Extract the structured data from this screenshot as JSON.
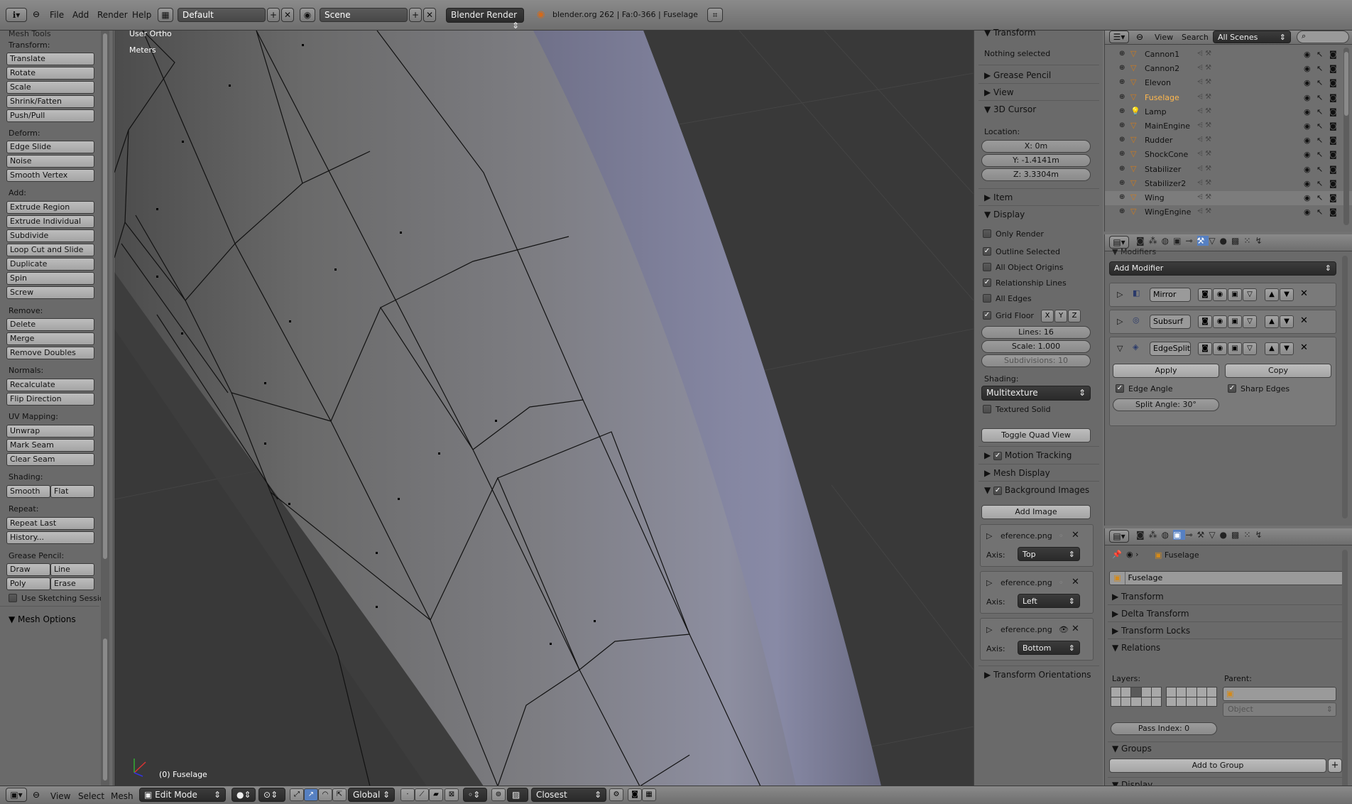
{
  "header": {
    "menus": [
      "File",
      "Add",
      "Render",
      "Help"
    ],
    "screen_layout": "Default",
    "scene": "Scene",
    "render_engine": "Blender Render",
    "stats": "blender.org 262 | Fa:0-366 | Fuselage"
  },
  "toolshelf": {
    "title": "Mesh Tools",
    "transform_label": "Transform:",
    "transform": [
      "Translate",
      "Rotate",
      "Scale",
      "Shrink/Fatten",
      "Push/Pull"
    ],
    "deform_label": "Deform:",
    "deform": [
      "Edge Slide",
      "Noise",
      "Smooth Vertex"
    ],
    "add_label": "Add:",
    "add": [
      "Extrude Region",
      "Extrude Individual",
      "Subdivide",
      "Loop Cut and Slide",
      "Duplicate",
      "Spin",
      "Screw"
    ],
    "remove_label": "Remove:",
    "remove": [
      "Delete",
      "Merge",
      "Remove Doubles"
    ],
    "normals_label": "Normals:",
    "normals": [
      "Recalculate",
      "Flip Direction"
    ],
    "uv_label": "UV Mapping:",
    "uv": [
      "Unwrap",
      "Mark Seam",
      "Clear Seam"
    ],
    "shading_label": "Shading:",
    "shading_smooth": "Smooth",
    "shading_flat": "Flat",
    "repeat_label": "Repeat:",
    "repeat": [
      "Repeat Last",
      "History..."
    ],
    "grease_label": "Grease Pencil:",
    "grease_draw": "Draw",
    "grease_line": "Line",
    "grease_poly": "Poly",
    "grease_erase": "Erase",
    "sketching": "Use Sketching Sessio",
    "mesh_options": "Mesh Options"
  },
  "viewport": {
    "view_name": "User Ortho",
    "units": "Meters",
    "object_label": "(0) Fuselage"
  },
  "npanel": {
    "transform": "Transform",
    "nothing_selected": "Nothing selected",
    "grease_pencil": "Grease Pencil",
    "view": "View",
    "cursor": "3D Cursor",
    "location": "Location:",
    "x": "X: 0m",
    "y": "Y: -1.4141m",
    "z": "Z: 3.3304m",
    "item": "Item",
    "display": "Display",
    "only_render": "Only Render",
    "outline_selected": "Outline Selected",
    "all_origins": "All Object Origins",
    "relationship_lines": "Relationship Lines",
    "all_edges": "All Edges",
    "grid_floor": "Grid Floor",
    "axis_x": "X",
    "axis_y": "Y",
    "axis_z": "Z",
    "lines": "Lines: 16",
    "scale": "Scale: 1.000",
    "subdivisions": "Subdivisions: 10",
    "shading": "Shading:",
    "shading_mode": "Multitexture",
    "textured_solid": "Textured Solid",
    "toggle_quad": "Toggle Quad View",
    "motion_tracking": "Motion Tracking",
    "mesh_display": "Mesh Display",
    "background_images": "Background Images",
    "add_image": "Add Image",
    "bg_images": [
      {
        "name": "eference.png",
        "axis_label": "Axis:",
        "axis": "Top"
      },
      {
        "name": "eference.png",
        "axis_label": "Axis:",
        "axis": "Left"
      },
      {
        "name": "eference.png",
        "axis_label": "Axis:",
        "axis": "Bottom"
      }
    ],
    "transform_orientations": "Transform Orientations"
  },
  "outliner": {
    "menus": [
      "View",
      "Search"
    ],
    "filter": "All Scenes",
    "items": [
      "Cannon1",
      "Cannon2",
      "Elevon",
      "Fuselage",
      "Lamp",
      "MainEngine",
      "Rudder",
      "ShockCone",
      "Stabilizer",
      "Stabilizer2",
      "Wing",
      "WingEngine"
    ]
  },
  "modifiers": {
    "header": "Modifiers",
    "add_modifier": "Add Modifier",
    "list": [
      "Mirror",
      "Subsurf",
      "EdgeSplit"
    ],
    "apply": "Apply",
    "copy": "Copy",
    "edge_angle": "Edge Angle",
    "sharp_edges": "Sharp Edges",
    "split_angle": "Split Angle: 30°"
  },
  "object_props": {
    "breadcrumb": "Fuselage",
    "name": "Fuselage",
    "panels": [
      "Transform",
      "Delta Transform",
      "Transform Locks",
      "Relations"
    ],
    "layers": "Layers:",
    "parent": "Parent:",
    "parent_type": "Object",
    "pass_index": "Pass Index: 0",
    "groups": "Groups",
    "add_to_group": "Add to Group",
    "display": "Display"
  },
  "bottombar": {
    "menus": [
      "View",
      "Select",
      "Mesh"
    ],
    "mode": "Edit Mode",
    "orientation": "Global",
    "snap": "Closest"
  },
  "colors": {
    "viewport_bg": "#393939",
    "mesh_light": "#8d8ea0",
    "mesh_dark": "#5a5a5a",
    "panel_bg": "#6a6a6a",
    "selected_orange": "#ffb84d"
  }
}
